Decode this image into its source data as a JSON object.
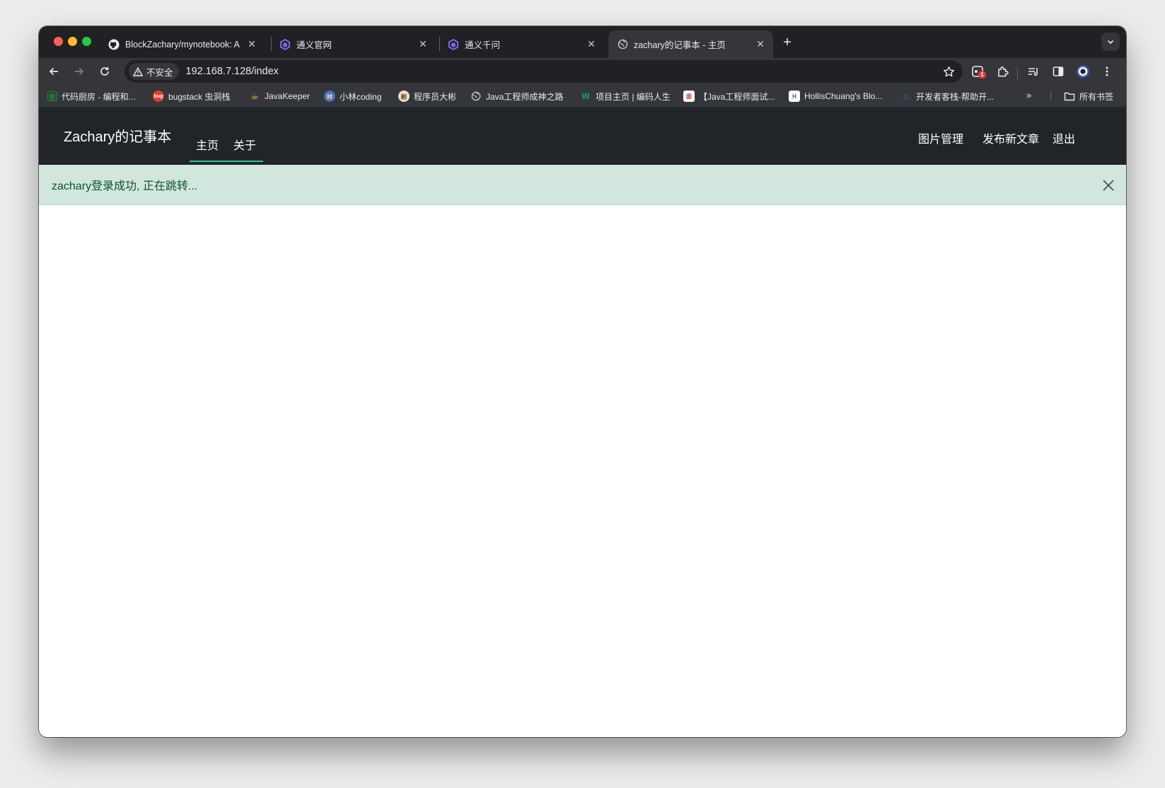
{
  "tabs": [
    {
      "title": "BlockZachary/mynotebook: A",
      "favicon": "github-icon",
      "active": false
    },
    {
      "title": "通义官网",
      "favicon": "tongyi-icon",
      "active": false
    },
    {
      "title": "通义千问",
      "favicon": "tongyi-icon",
      "active": false
    },
    {
      "title": "zachary的记事本 - 主页",
      "favicon": "globe-icon",
      "active": true
    }
  ],
  "toolbar": {
    "security_label": "不安全",
    "url": "192.168.7.128/index",
    "extension_badge": "1"
  },
  "bookmarks": [
    {
      "label": "代码厨房 - 编程和...",
      "icon": "code-kitchen-icon",
      "color": "#1b8f3a"
    },
    {
      "label": "bugstack 虫洞栈",
      "icon": "bugstack-icon",
      "color": "#e53935"
    },
    {
      "label": "JavaKeeper",
      "icon": "javakeeper-icon",
      "color": "#f2c230"
    },
    {
      "label": "小林coding",
      "icon": "xiaolin-icon",
      "color": "#3f6fd8"
    },
    {
      "label": "程序员大彬",
      "icon": "dabin-icon",
      "color": "#f4e4c8"
    },
    {
      "label": "Java工程师成神之路",
      "icon": "globe-icon",
      "color": "#9aa0a6"
    },
    {
      "label": "项目主页 | 编码人生",
      "icon": "w-icon",
      "color": "#16a085"
    },
    {
      "label": "【Java工程师面试...",
      "icon": "interview-icon",
      "color": "#ffffff"
    },
    {
      "label": "HollisChuang's Blo...",
      "icon": "hollis-icon",
      "color": "#ffffff"
    },
    {
      "label": "开发者客栈-帮助开...",
      "icon": "kezhan-icon",
      "color": "#3b6fd6"
    }
  ],
  "bookmarks_more": "»",
  "all_bookmarks": "所有书签",
  "site": {
    "brand": "Zachary的记事本",
    "nav_left": [
      "主页",
      "关于"
    ],
    "nav_right": [
      "图片管理",
      "发布新文章",
      "退出"
    ],
    "accent": "#20c997"
  },
  "alert": {
    "message": "zachary登录成功, 正在跳转...",
    "bg": "#d1e7dd",
    "text_color": "#0f5132"
  }
}
